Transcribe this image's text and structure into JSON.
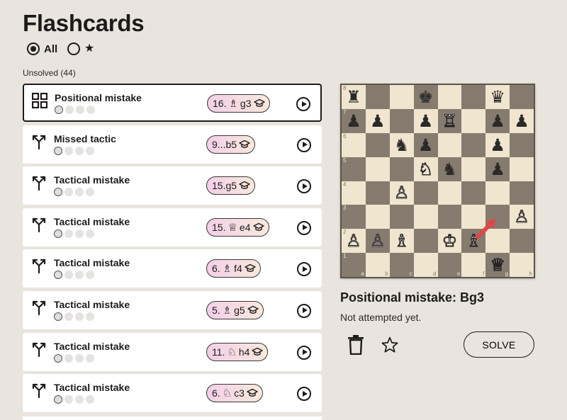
{
  "page_title": "Flashcards",
  "filters": {
    "all_label": "All",
    "starred_label": "★",
    "selected": "All"
  },
  "section_label": "Unsolved (44)",
  "cards": [
    {
      "icon": "grid-icon",
      "title": "Positional mistake",
      "move_prefix": "16.",
      "piece": "♗",
      "move_suffix": "g3",
      "selected": true
    },
    {
      "icon": "fork-icon",
      "title": "Missed tactic",
      "move_prefix": "9...b5",
      "piece": "",
      "move_suffix": "",
      "selected": false
    },
    {
      "icon": "fork-icon",
      "title": "Tactical mistake",
      "move_prefix": "15.g5",
      "piece": "",
      "move_suffix": "",
      "selected": false
    },
    {
      "icon": "fork-icon",
      "title": "Tactical mistake",
      "move_prefix": "15.",
      "piece": "♕",
      "move_suffix": "e4",
      "selected": false
    },
    {
      "icon": "fork-icon",
      "title": "Tactical mistake",
      "move_prefix": "6.",
      "piece": "♗",
      "move_suffix": "f4",
      "selected": false
    },
    {
      "icon": "fork-icon",
      "title": "Tactical mistake",
      "move_prefix": "5.",
      "piece": "♗",
      "move_suffix": "g5",
      "selected": false
    },
    {
      "icon": "fork-icon",
      "title": "Tactical mistake",
      "move_prefix": "11.",
      "piece": "♘",
      "move_suffix": "h4",
      "selected": false
    },
    {
      "icon": "fork-icon",
      "title": "Tactical mistake",
      "move_prefix": "6.",
      "piece": "♘",
      "move_suffix": "c3",
      "selected": false
    }
  ],
  "board": {
    "ranks": [
      "8",
      "7",
      "6",
      "5",
      "4",
      "3",
      "2",
      "1"
    ],
    "files": [
      "a",
      "b",
      "c",
      "d",
      "e",
      "f",
      "g",
      "h"
    ],
    "position": [
      [
        "r",
        "",
        "",
        "k",
        "",
        "",
        "q",
        ""
      ],
      [
        "p",
        "p",
        "",
        "p",
        "R",
        "",
        "p",
        "p"
      ],
      [
        "",
        "",
        "n",
        "p",
        "",
        "",
        "p",
        ""
      ],
      [
        "",
        "",
        "",
        "N",
        "n",
        "",
        "p",
        ""
      ],
      [
        "",
        "",
        "P",
        "",
        "",
        "",
        "",
        ""
      ],
      [
        "",
        "",
        "",
        "",
        "",
        "",
        "",
        "P"
      ],
      [
        "P",
        "P",
        "B",
        "",
        "K",
        "B",
        "",
        ""
      ],
      [
        "",
        "",
        "",
        "",
        "",
        "",
        "Q",
        ""
      ]
    ],
    "arrow": {
      "from": "f2",
      "to": "g3",
      "color": "#e0474a"
    }
  },
  "detail": {
    "title": "Positional mistake: Bg3",
    "status": "Not attempted yet."
  },
  "actions": {
    "delete_icon": "trash-icon",
    "star_icon": "star-icon",
    "solve_label": "SOLVE"
  }
}
